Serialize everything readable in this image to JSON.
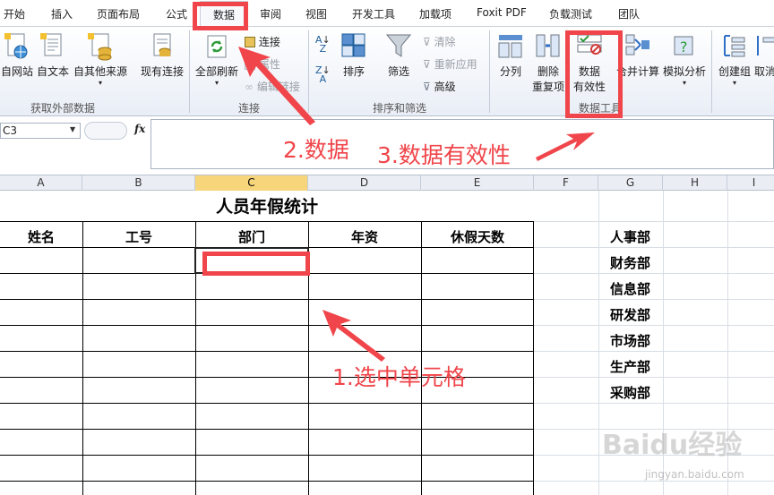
{
  "ribbon_tabs": [
    "开始",
    "插入",
    "页面布局",
    "公式",
    "数据",
    "审阅",
    "视图",
    "开发工具",
    "加载项",
    "Foxit PDF",
    "负载测试",
    "团队"
  ],
  "groups": {
    "external": {
      "title": "获取外部数据",
      "buttons": [
        "自网站",
        "自文本",
        "自其他来源",
        "现有连接"
      ]
    },
    "connections": {
      "title": "连接",
      "refresh_all": "全部刷新",
      "connect": "连接",
      "properties": "属性",
      "edit_links": "编辑链接"
    },
    "sort_filter": {
      "title": "排序和筛选",
      "sort": "排序",
      "filter": "筛选",
      "clear": "清除",
      "reapply": "重新应用",
      "advanced": "高级"
    },
    "data_tools": {
      "title": "数据工具",
      "split": "分列",
      "remove_dup_1": "删除",
      "remove_dup_2": "重复项",
      "validation_1": "数据",
      "validation_2": "有效性",
      "consolidate": "合并计算",
      "whatif": "模拟分析"
    },
    "outline": {
      "group": "创建组",
      "ungroup": "取消"
    }
  },
  "formula_bar": {
    "name_box": "C3",
    "fx": "fx",
    "content": ""
  },
  "columns": [
    "A",
    "B",
    "C",
    "D",
    "E",
    "F",
    "G",
    "H",
    "I"
  ],
  "sheet": {
    "title": "人员年假统计",
    "headers": [
      "姓名",
      "工号",
      "部门",
      "年资",
      "休假天数"
    ],
    "departments": [
      "人事部",
      "财务部",
      "信息部",
      "研发部",
      "市场部",
      "生产部",
      "采购部"
    ]
  },
  "annotations": {
    "step1": "1.选中单元格",
    "step2": "2.数据",
    "step3": "3.数据有效性"
  },
  "watermark": {
    "logo": "Baidu经验",
    "url": "jingyan.baidu.com"
  },
  "colors": {
    "annotation_red": "#f0454a",
    "selected_column": "#f7d57a"
  }
}
